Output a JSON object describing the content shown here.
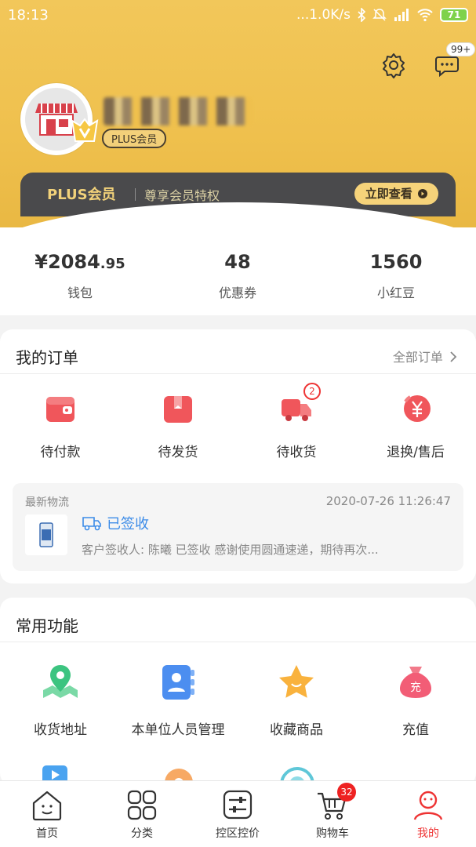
{
  "status_bar": {
    "time": "18:13",
    "network": "...1.0K/s",
    "battery": "71"
  },
  "header": {
    "messages_badge": "99+",
    "membership_tag": "PLUS会员"
  },
  "plus_banner": {
    "title": "PLUS会员",
    "subtitle": "尊享会员特权",
    "button": "立即查看"
  },
  "stats": [
    {
      "value_main": "¥2084",
      "value_decimal": ".95",
      "label": "钱包"
    },
    {
      "value_main": "48",
      "value_decimal": "",
      "label": "优惠券"
    },
    {
      "value_main": "1560",
      "value_decimal": "",
      "label": "小红豆"
    }
  ],
  "orders": {
    "title": "我的订单",
    "all_link": "全部订单",
    "items": [
      {
        "label": "待付款",
        "badge": ""
      },
      {
        "label": "待发货",
        "badge": ""
      },
      {
        "label": "待收货",
        "badge": "2"
      },
      {
        "label": "退换/售后",
        "badge": ""
      }
    ],
    "logistics": {
      "heading": "最新物流",
      "time": "2020-07-26 11:26:47",
      "status": "已签收",
      "description": "客户签收人: 陈曦 已签收 感谢使用圆通速递，期待再次..."
    }
  },
  "functions": {
    "title": "常用功能",
    "items": [
      {
        "label": "收货地址"
      },
      {
        "label": "本单位人员管理"
      },
      {
        "label": "收藏商品"
      },
      {
        "label": "充值"
      }
    ]
  },
  "bottom_nav": [
    {
      "label": "首页"
    },
    {
      "label": "分类"
    },
    {
      "label": "控区控价"
    },
    {
      "label": "购物车",
      "badge": "32"
    },
    {
      "label": "我的"
    }
  ]
}
